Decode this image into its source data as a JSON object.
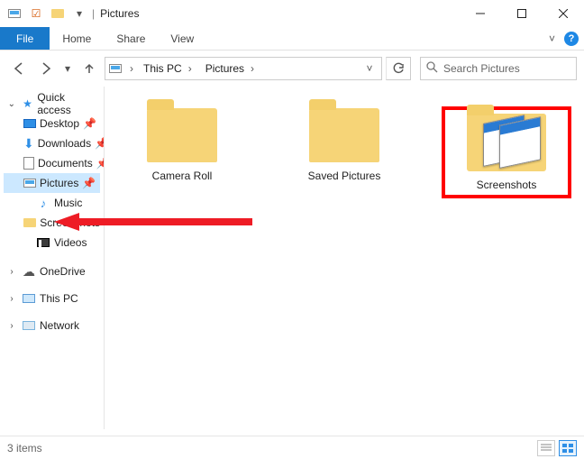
{
  "title": "Pictures",
  "ribbon": {
    "file": "File",
    "tabs": [
      "Home",
      "Share",
      "View"
    ]
  },
  "breadcrumb": {
    "root": "This PC",
    "current": "Pictures"
  },
  "search": {
    "placeholder": "Search Pictures"
  },
  "navtree": {
    "quick_access": "Quick access",
    "items": [
      {
        "label": "Desktop",
        "icon": "desktop",
        "pinned": true
      },
      {
        "label": "Downloads",
        "icon": "download",
        "pinned": true
      },
      {
        "label": "Documents",
        "icon": "doc",
        "pinned": true
      },
      {
        "label": "Pictures",
        "icon": "pictures",
        "pinned": true,
        "selected": true
      },
      {
        "label": "Music",
        "icon": "music",
        "pinned": false
      },
      {
        "label": "Screenshots",
        "icon": "folder",
        "pinned": false
      },
      {
        "label": "Videos",
        "icon": "video",
        "pinned": false
      }
    ],
    "roots": [
      {
        "label": "OneDrive",
        "icon": "cloud"
      },
      {
        "label": "This PC",
        "icon": "pc"
      },
      {
        "label": "Network",
        "icon": "net"
      }
    ]
  },
  "content": {
    "items": [
      {
        "label": "Camera Roll",
        "type": "folder"
      },
      {
        "label": "Saved Pictures",
        "type": "folder"
      },
      {
        "label": "Screenshots",
        "type": "folder-preview",
        "highlighted": true
      }
    ]
  },
  "status": {
    "count": "3 items"
  }
}
